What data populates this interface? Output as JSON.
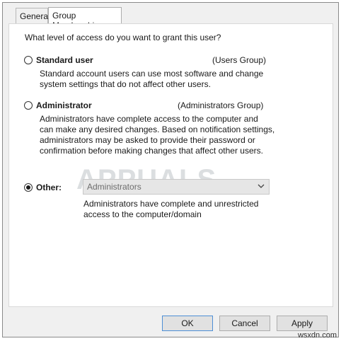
{
  "tabs": [
    {
      "label": "General"
    },
    {
      "label": "Group Membership"
    }
  ],
  "prompt": "What level of access do you want to grant this user?",
  "options": {
    "standard": {
      "label": "Standard user",
      "group": "(Users Group)",
      "desc_lines": [
        "Standard account users can use most software and change",
        "system settings that do not affect other users."
      ]
    },
    "administrator": {
      "label": "Administrator",
      "group": "(Administrators Group)",
      "desc_lines": [
        "Administrators have complete access to the computer and",
        "can make any desired changes. Based on notification settings,",
        "administrators may be asked to provide their password or",
        "confirmation before making changes that affect other users."
      ]
    },
    "other": {
      "label": "Other:",
      "selected_value": "Administrators",
      "desc_lines": [
        "Administrators have complete and unrestricted",
        "access to the computer/domain"
      ]
    }
  },
  "selected_option": "other",
  "buttons": {
    "ok": "OK",
    "cancel": "Cancel",
    "apply": "Apply"
  },
  "watermark": "APPUALS",
  "site": "wsxdn.com",
  "icons": {
    "dropdown": "chevron-down-icon"
  }
}
